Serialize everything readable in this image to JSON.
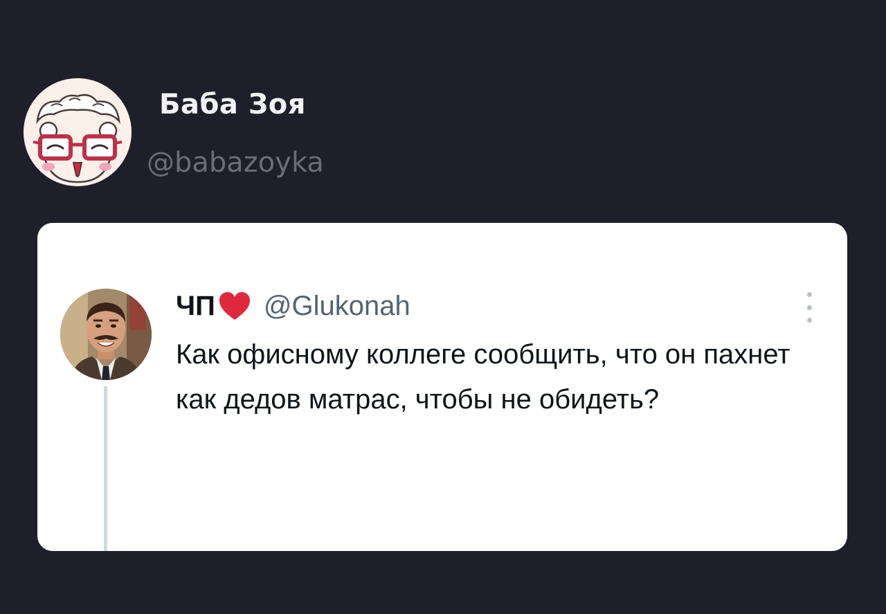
{
  "author": {
    "name": "Баба Зоя",
    "handle": "@babazoyka",
    "avatar_icon": "cartoon-grandma-avatar"
  },
  "quoted_tweet": {
    "name": "ЧП",
    "name_emoji_icon": "red-heart-icon",
    "handle": "@Glukonah",
    "text": "Как офисному коллеге сообщить, что он пахнет как дедов матрас, чтобы не обидеть?",
    "avatar_icon": "mustached-man-photo-avatar",
    "more_icon": "vertical-dots-icon"
  },
  "colors": {
    "background": "#1f1f2c",
    "card": "#ffffff",
    "heart": "#e0283c",
    "secondary_text": "#536471"
  }
}
